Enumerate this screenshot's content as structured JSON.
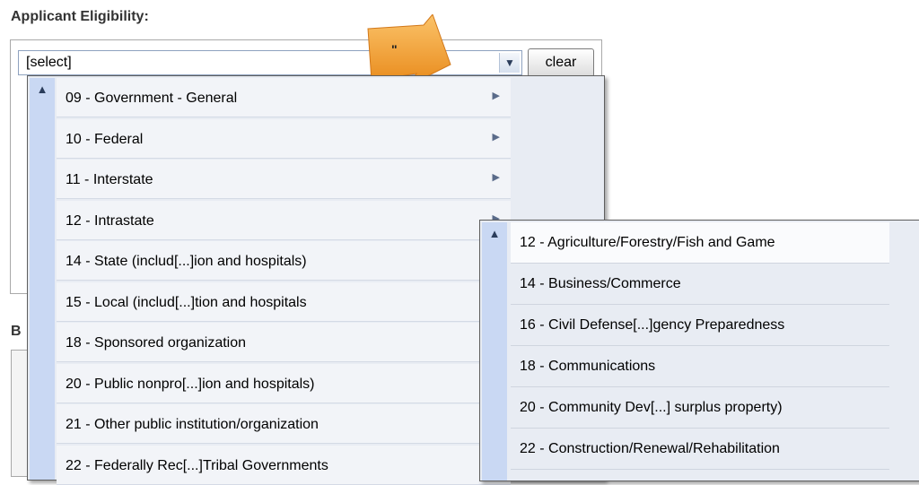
{
  "section": {
    "title": "Applicant Eligibility:"
  },
  "select": {
    "value": "[select]"
  },
  "clear_button": {
    "label": "clear"
  },
  "background_fragments": {
    "partial_label": "B"
  },
  "callout": {
    "text": "\""
  },
  "menu": {
    "items": [
      "09 - Government - General",
      "10 - Federal",
      "11 - Interstate",
      "12 - Intrastate",
      "14 - State (includ[...]ion and hospitals)",
      "15 - Local (includ[...]tion and hospitals",
      "18 - Sponsored organization",
      "20 - Public nonpro[...]ion and hospitals)",
      "21 - Other public institution/organization",
      "22 - Federally Rec[...]Tribal Governments"
    ]
  },
  "submenu": {
    "items": [
      "12 - Agriculture/Forestry/Fish and Game",
      "14 - Business/Commerce",
      "16 - Civil Defense[...]gency Preparedness",
      "18 - Communications",
      "20 - Community Dev[...] surplus property)",
      "22 - Construction/Renewal/Rehabilitation"
    ]
  },
  "colors": {
    "callout_orange": "#f5a623",
    "scroll_track": "#c9d8f3",
    "menu_background": "#e8ecf3"
  }
}
